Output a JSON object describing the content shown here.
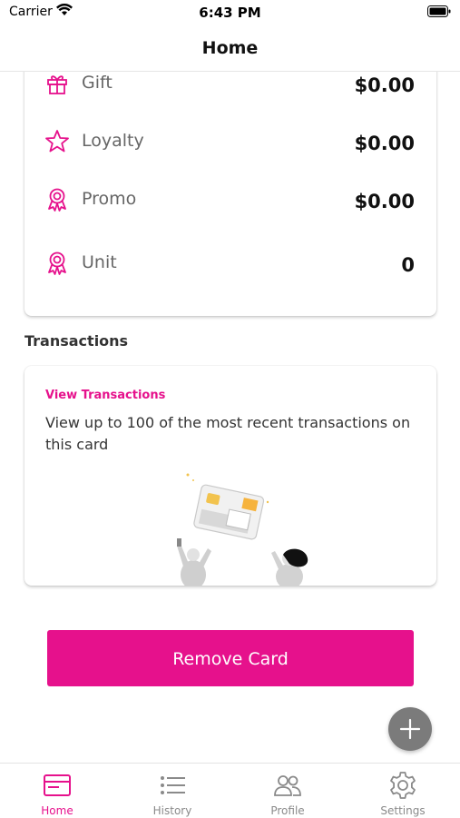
{
  "status_bar": {
    "carrier": "Carrier",
    "time": "6:43 PM"
  },
  "nav": {
    "title": "Home"
  },
  "balances": [
    {
      "label": "Gift",
      "amount": "$0.00",
      "icon": "gift-icon"
    },
    {
      "label": "Loyalty",
      "amount": "$0.00",
      "icon": "star-icon"
    },
    {
      "label": "Promo",
      "amount": "$0.00",
      "icon": "ribbon-icon"
    },
    {
      "label": "Unit",
      "amount": "0",
      "icon": "ribbon-icon"
    }
  ],
  "transactions": {
    "section_title": "Transactions",
    "link": "View Transactions",
    "description": "View up to 100 of the most recent transactions on this card"
  },
  "remove_button": "Remove Card",
  "tabs": [
    {
      "label": "Home",
      "icon": "card-icon",
      "active": true
    },
    {
      "label": "History",
      "icon": "list-icon",
      "active": false
    },
    {
      "label": "Profile",
      "icon": "users-icon",
      "active": false
    },
    {
      "label": "Settings",
      "icon": "gear-icon",
      "active": false
    }
  ],
  "colors": {
    "accent": "#e6118c",
    "fab": "#7b7b7b"
  }
}
